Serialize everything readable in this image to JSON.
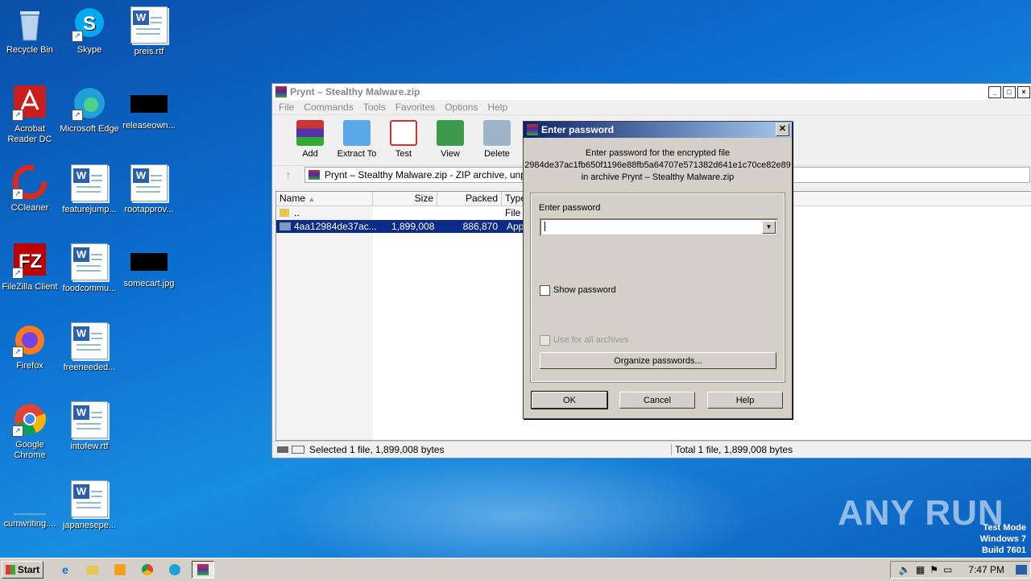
{
  "desktop": {
    "icons": [
      {
        "label": "Recycle Bin"
      },
      {
        "label": "Skype"
      },
      {
        "label": "preis.rtf"
      },
      {
        "label": "Acrobat Reader DC"
      },
      {
        "label": "Microsoft Edge"
      },
      {
        "label": "releaseown..."
      },
      {
        "label": "CCleaner"
      },
      {
        "label": "featurejump..."
      },
      {
        "label": "rootapprov..."
      },
      {
        "label": "FileZilla Client"
      },
      {
        "label": "foodcommu..."
      },
      {
        "label": "somecart.jpg"
      },
      {
        "label": "Firefox"
      },
      {
        "label": "freeneeded..."
      },
      {
        "label": "Google Chrome"
      },
      {
        "label": "intofew.rtf"
      },
      {
        "label": "cumwriting...."
      },
      {
        "label": "japanesepe..."
      }
    ]
  },
  "winrar": {
    "title": "Prynt – Stealthy Malware.zip",
    "menu": [
      "File",
      "Commands",
      "Tools",
      "Favorites",
      "Options",
      "Help"
    ],
    "toolbar": [
      "Add",
      "Extract To",
      "Test",
      "View",
      "Delete"
    ],
    "address": "Prynt – Stealthy Malware.zip - ZIP archive, unpa",
    "columns": [
      "Name",
      "Size",
      "Packed",
      "Type"
    ],
    "rows": [
      {
        "name": "..",
        "size": "",
        "packed": "",
        "type": "File f"
      },
      {
        "name": "4aa12984de37ac...",
        "size": "1,899,008",
        "packed": "886,870",
        "type": "Appl"
      }
    ],
    "status_left": "Selected 1 file, 1,899,008 bytes",
    "status_right": "Total 1 file, 1,899,008 bytes"
  },
  "dialog": {
    "title": "Enter password",
    "msg1": "Enter password for the encrypted file",
    "msg2": "2984de37ac1fb650f1196e88fb5a64707e571382d641e1c70ce82e89",
    "msg3": "in archive Prynt – Stealthy Malware.zip",
    "field_label": "Enter password",
    "password_value": "",
    "show_password": "Show password",
    "use_all": "Use for all archives",
    "organize": "Organize passwords...",
    "ok": "OK",
    "cancel": "Cancel",
    "help": "Help"
  },
  "taskbar": {
    "start": "Start",
    "clock": "7:47 PM"
  },
  "watermark": "ANY RUN",
  "testmode": {
    "l1": "Test Mode",
    "l2": "Windows 7",
    "l3": "Build 7601"
  }
}
